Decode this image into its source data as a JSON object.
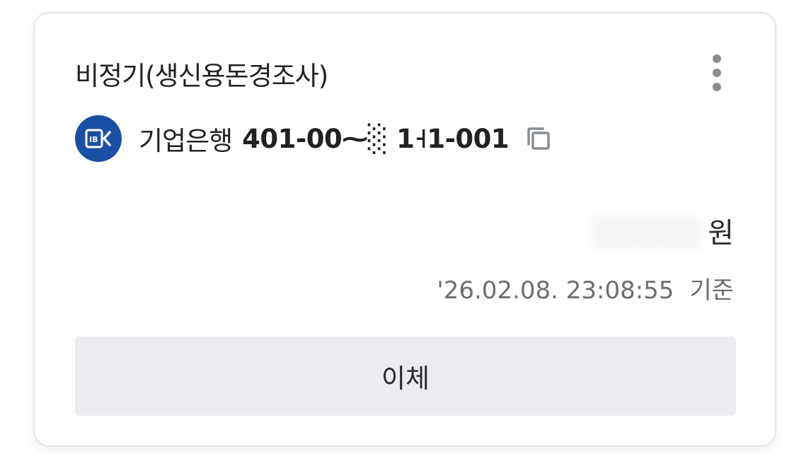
{
  "card": {
    "title": "비정기(생신용돈경조사)",
    "menu_icon": "more-vertical-icon"
  },
  "account": {
    "bank_logo_icon": "ibk-bank-logo-icon",
    "bank_name": "기업은행",
    "account_number": "401-00⁓░ 1˧1-001",
    "copy_icon": "copy-icon"
  },
  "balance": {
    "masked_amount": "░░░░░",
    "unit": "원"
  },
  "timestamp": {
    "datetime": "'26.02.08. 23:08:55",
    "suffix": "기준"
  },
  "actions": {
    "transfer_label": "이체"
  },
  "colors": {
    "bank_blue": "#1a4fa3",
    "button_bg": "#eaecef",
    "text_primary": "#222222",
    "text_secondary": "#6b6e73"
  }
}
